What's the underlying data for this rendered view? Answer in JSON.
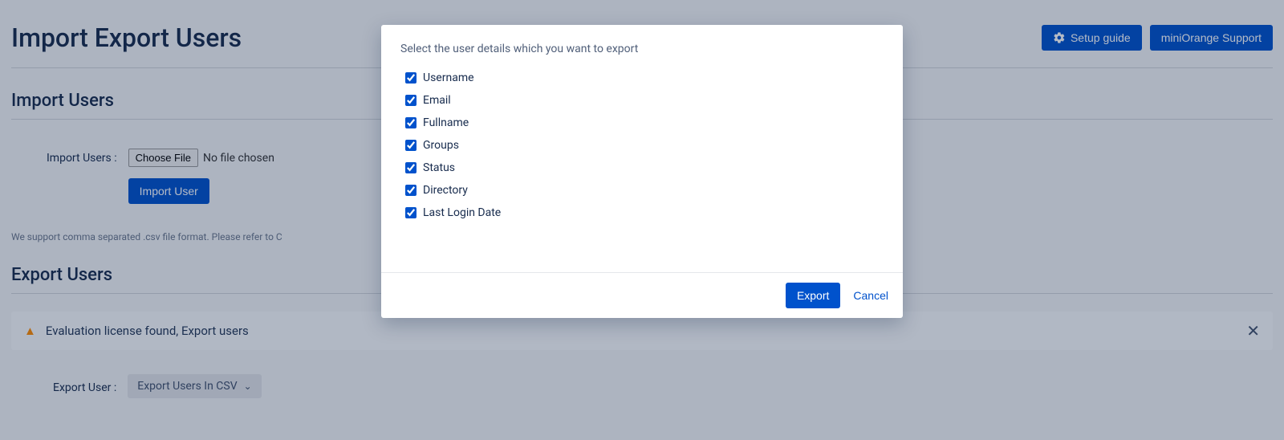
{
  "header": {
    "title": "Import Export Users",
    "setup_guide": "Setup guide",
    "support": "miniOrange Support"
  },
  "import": {
    "section_title": "Import Users",
    "label": "Import Users :",
    "choose_file": "Choose File",
    "no_file": "No file chosen",
    "import_btn": "Import User",
    "help": "We support comma separated .csv file format. Please refer to C"
  },
  "export": {
    "section_title": "Export Users",
    "warning": "Evaluation license found, Export users",
    "label": "Export User :",
    "dropdown": "Export Users In CSV"
  },
  "modal": {
    "instruction": "Select the user details which you want to export",
    "fields": [
      "Username",
      "Email",
      "Fullname",
      "Groups",
      "Status",
      "Directory",
      "Last Login Date"
    ],
    "export_btn": "Export",
    "cancel_btn": "Cancel"
  }
}
